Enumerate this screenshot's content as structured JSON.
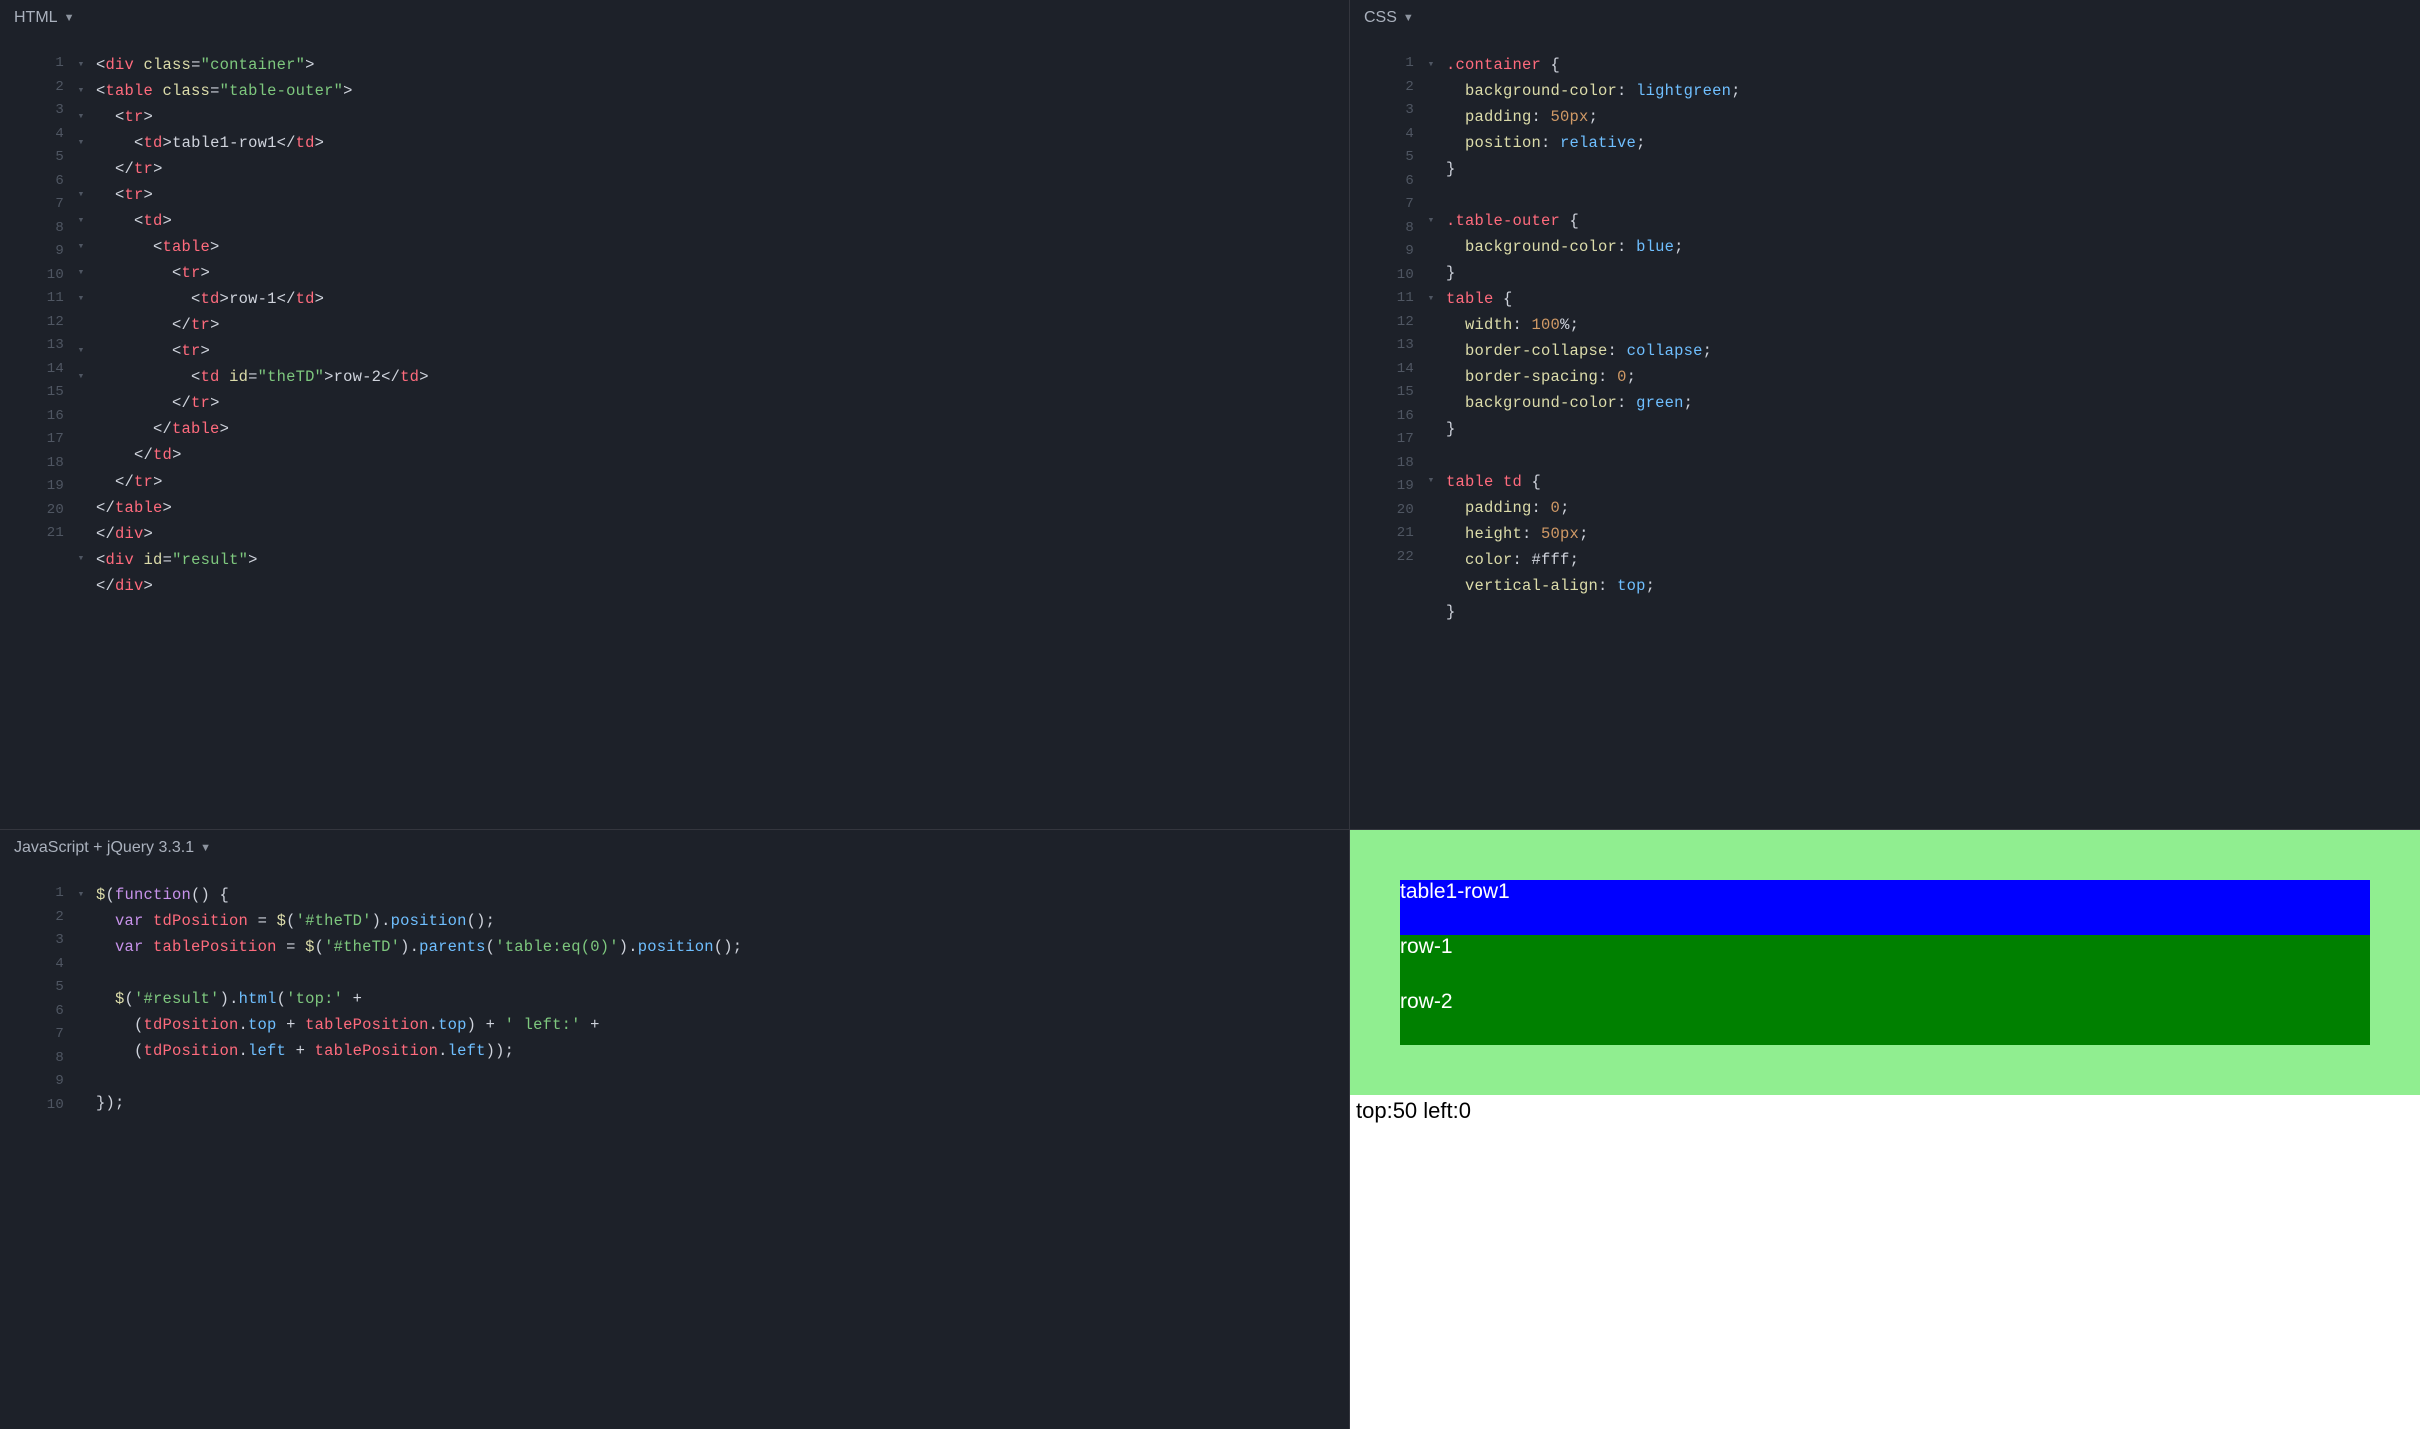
{
  "panes": {
    "html": {
      "label": "HTML"
    },
    "css": {
      "label": "CSS"
    },
    "js": {
      "label": "JavaScript + jQuery 3.3.1"
    }
  },
  "html_code": {
    "lines": [
      "<div class=\"container\">",
      "<table class=\"table-outer\">",
      "  <tr>",
      "    <td>table1-row1</td>",
      "  </tr>",
      "  <tr>",
      "    <td>",
      "      <table>",
      "        <tr>",
      "          <td>row-1</td>",
      "        </tr>",
      "        <tr>",
      "          <td id=\"theTD\">row-2</td>",
      "        </tr>",
      "      </table>",
      "    </td>",
      "  </tr>",
      "</table>",
      "</div>",
      "<div id=\"result\">",
      "</div>"
    ],
    "fold_rows": [
      1,
      2,
      3,
      4,
      6,
      7,
      8,
      9,
      10,
      12,
      13,
      20
    ],
    "line_count": 21
  },
  "css_code": {
    "lines": [
      ".container {",
      "  background-color: lightgreen;",
      "  padding: 50px;",
      "  position: relative;",
      "}",
      "",
      ".table-outer {",
      "  background-color: blue;",
      "}",
      "table {",
      "  width: 100%;",
      "  border-collapse: collapse;",
      "  border-spacing: 0;",
      "  background-color: green;",
      "}",
      "",
      "table td {",
      "  padding: 0;",
      "  height: 50px;",
      "  color: #fff;",
      "  vertical-align: top;",
      "}"
    ],
    "fold_rows": [
      1,
      7,
      10,
      17
    ],
    "line_count": 22
  },
  "js_code": {
    "lines": [
      "$(function() {",
      "  var tdPosition = $('#theTD').position();",
      "  var tablePosition = $('#theTD').parents('table:eq(0)').position();",
      "",
      "  $('#result').html('top:' +",
      "    (tdPosition.top + tablePosition.top) + ' left:' +",
      "    (tdPosition.left + tablePosition.left));",
      "",
      "});",
      ""
    ],
    "fold_rows": [
      1
    ],
    "line_count": 10
  },
  "preview": {
    "outer_row1": "table1-row1",
    "inner_row1": "row-1",
    "inner_row2": "row-2",
    "result_text": "top:50 left:0"
  }
}
